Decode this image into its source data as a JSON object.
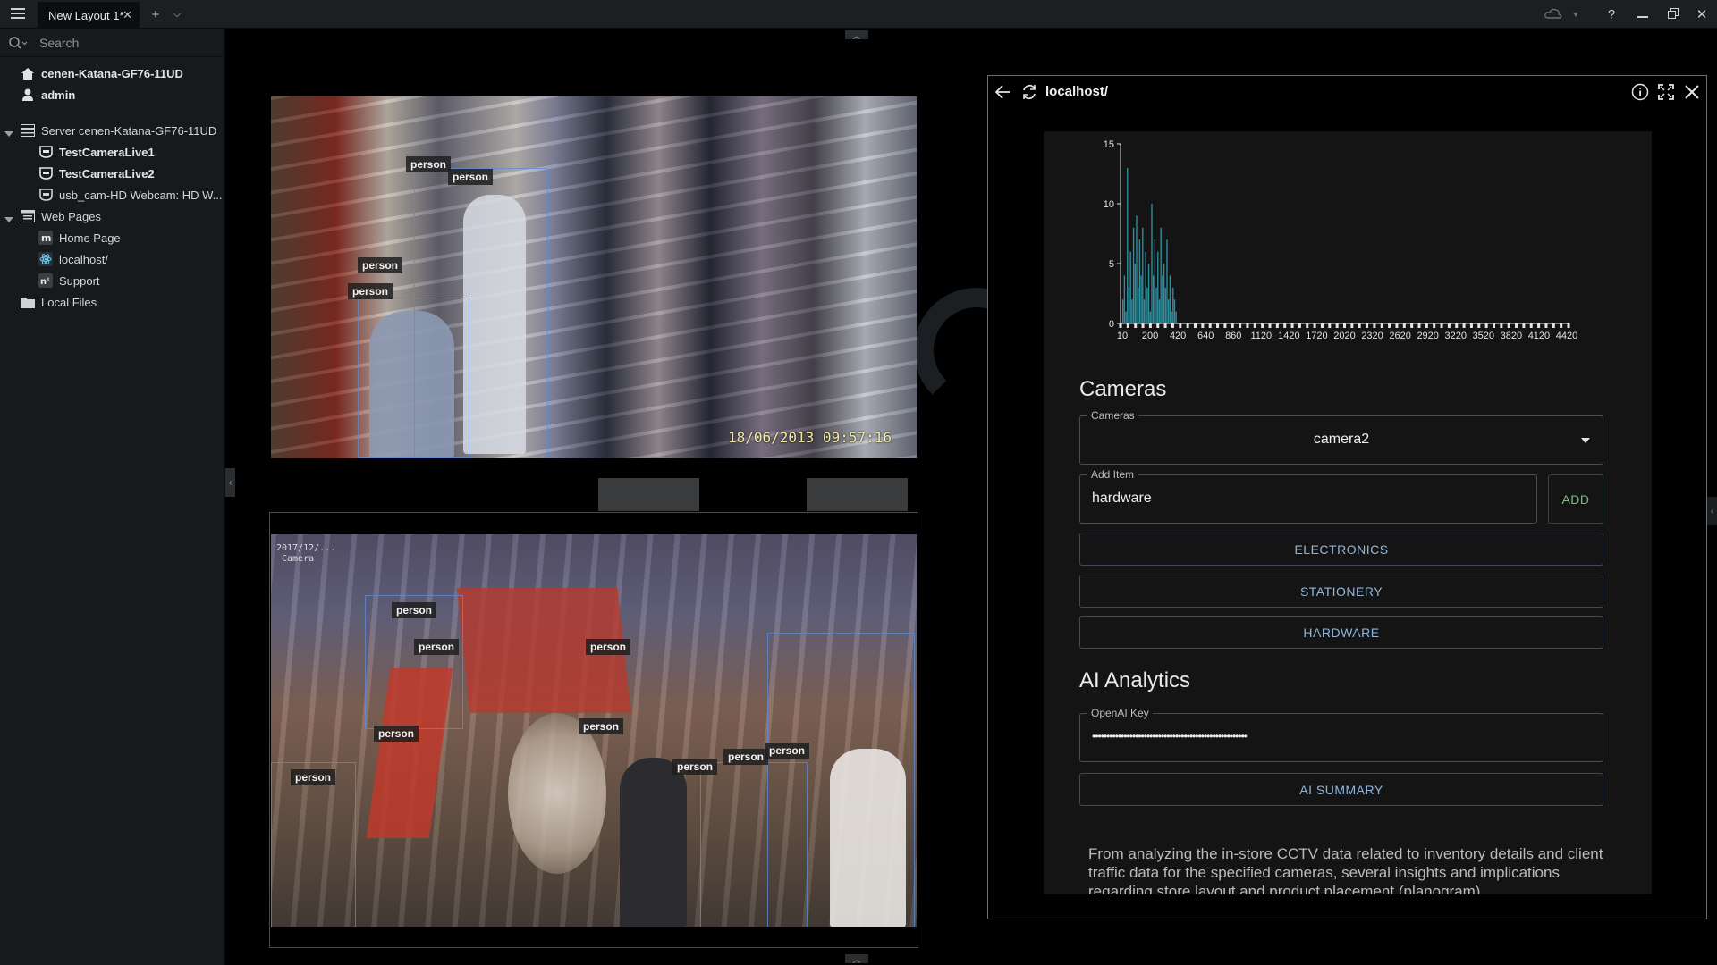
{
  "window": {
    "tab_title": "New Layout 1*"
  },
  "sidebar": {
    "search_placeholder": "Search",
    "items": [
      {
        "label": "cenen-Katana-GF76-11UD"
      },
      {
        "label": "admin"
      },
      {
        "label": "Server cenen-Katana-GF76-11UD"
      },
      {
        "label": "TestCameraLive1"
      },
      {
        "label": "TestCameraLive2"
      },
      {
        "label": "usb_cam-HD Webcam: HD W..."
      },
      {
        "label": "Web Pages"
      },
      {
        "label": "Home Page"
      },
      {
        "label": "localhost/"
      },
      {
        "label": "Support"
      },
      {
        "label": "Local Files"
      }
    ]
  },
  "cameras": {
    "top": {
      "timestamp": "18/06/2013 09:57:16",
      "labels": [
        "person",
        "person",
        "person",
        "person"
      ]
    },
    "bottom": {
      "timestamp": "2017/12/...",
      "overlay_text": "Camera",
      "labels": [
        "person",
        "person",
        "person",
        "person",
        "person",
        "person",
        "person",
        "person",
        "person"
      ]
    }
  },
  "webpanel": {
    "title": "localhost/",
    "cameras_section": {
      "heading": "Cameras",
      "select_label": "Cameras",
      "select_value": "camera2",
      "add_label": "Add Item",
      "add_value": "hardware",
      "add_button": "ADD",
      "items": [
        "ELECTRONICS",
        "STATIONERY",
        "HARDWARE"
      ]
    },
    "ai_section": {
      "heading": "AI Analytics",
      "key_label": "OpenAI Key",
      "key_value": "••••••••••••••••••••••••••••••••••••••••••••••••••••••",
      "summary_button": "AI SUMMARY",
      "summary_text": "From analyzing the in-store CCTV data related to inventory details and client traffic data for the specified cameras, several insights and implications regarding store layout and product placement (planogram)"
    }
  },
  "chart_data": {
    "type": "bar",
    "yticks": [
      "15",
      "10",
      "5",
      "0"
    ],
    "ylim": [
      0,
      15
    ],
    "xticks": [
      "10",
      "200",
      "420",
      "640",
      "860",
      "1120",
      "1420",
      "1720",
      "2020",
      "2320",
      "2620",
      "2920",
      "3220",
      "3520",
      "3820",
      "4120",
      "4420"
    ],
    "values": [
      2,
      4,
      1,
      13,
      3,
      6,
      2,
      8,
      5,
      9,
      3,
      7,
      4,
      8,
      2,
      6,
      3,
      5,
      1,
      10,
      4,
      7,
      3,
      6,
      2,
      8,
      4,
      5,
      3,
      7,
      2,
      4,
      1,
      3,
      2,
      1
    ],
    "bar_color": "#2f8f9f"
  }
}
